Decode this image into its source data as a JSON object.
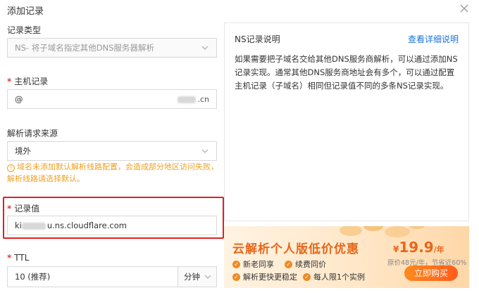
{
  "dialog": {
    "title": "添加记录"
  },
  "record_type": {
    "label": "记录类型",
    "value": "NS- 将子域名指定其他DNS服务器解析"
  },
  "host_record": {
    "label": "主机记录",
    "value": "@",
    "suffix": ".cn"
  },
  "resolve_source": {
    "label": "解析请求来源",
    "value": "境外",
    "warning": "域名未添加默认解析线路配置，会造成部分地区访问失败，解析线路请选择默认。"
  },
  "record_value": {
    "label": "记录值",
    "value_prefix": "ki",
    "value_suffix": "u.ns.cloudflare.com"
  },
  "ttl": {
    "label": "TTL",
    "value": "10 (推荐)",
    "unit": "分钟"
  },
  "help_panel": {
    "title": "NS记录说明",
    "link": "查看详细说明",
    "body": "如果需要把子域名交给其他DNS服务商解析，可以通过添加NS记录实现。通常其他DNS服务商地址会有多个，可以通过配置主机记录（子域名）相同但记录值不同的多条NS记录实现。"
  },
  "promo": {
    "title": "云解析个人版低价优惠",
    "perks": [
      "新老同享",
      "续费同价",
      "解析更快更稳定",
      "每人限1个实例"
    ],
    "currency": "¥",
    "price": "19.9",
    "period": "/年",
    "note": "原价48元/年，节省近60%",
    "button": "立即购买"
  },
  "colors": {
    "accent": "#1a73d9",
    "warning": "#f0a020",
    "promo": "#e8661a",
    "highlight": "#e02020"
  }
}
